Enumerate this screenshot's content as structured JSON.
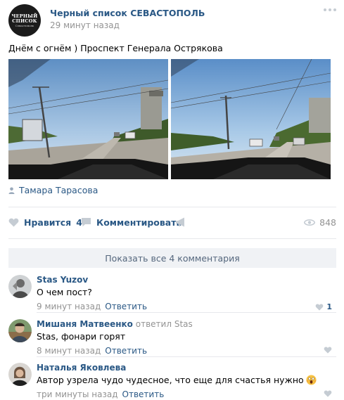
{
  "post": {
    "group_name": "Черный список СЕВАСТОПОЛЬ",
    "time": "29 минут назад",
    "avatar_lines": [
      "ЧЕРНЫЙ",
      "СПИСОК",
      "Севастополь"
    ],
    "text": "Днём с огнём ) Проспект Генерала Острякова",
    "author": "Тамара Тарасова",
    "icons": [
      "more-icon",
      "person-icon",
      "heart-icon",
      "comment-icon",
      "share-icon",
      "eye-icon"
    ]
  },
  "actions": {
    "like_label": "Нравится",
    "like_count": "4",
    "comment_label": "Комментировать",
    "views": "848"
  },
  "show_all": "Показать все 4 комментария",
  "comments": [
    {
      "author": "Stas Yuzov",
      "reply_to": "",
      "reply_name": "",
      "text": "О чем пост?",
      "time": "9 минут назад",
      "reply_label": "Ответить",
      "likes": "1"
    },
    {
      "author": "Мишаня Матвеенко",
      "reply_to": "ответил",
      "reply_name": "Stas",
      "text": "Stas, фонари горят",
      "time": "8 минут назад",
      "reply_label": "Ответить",
      "likes": ""
    },
    {
      "author": "Наталья Яковлева",
      "reply_to": "",
      "reply_name": "",
      "text": "Автор узрела чудо чудесное, что еще для счастья нужно",
      "time": "три минуты назад",
      "reply_label": "Ответить",
      "likes": ""
    }
  ],
  "colors": {
    "link": "#2a5885",
    "muted": "#939393",
    "icon": "#c5ccd3",
    "divider": "#e7e8ec",
    "show_all_bg": "#f0f2f5"
  }
}
